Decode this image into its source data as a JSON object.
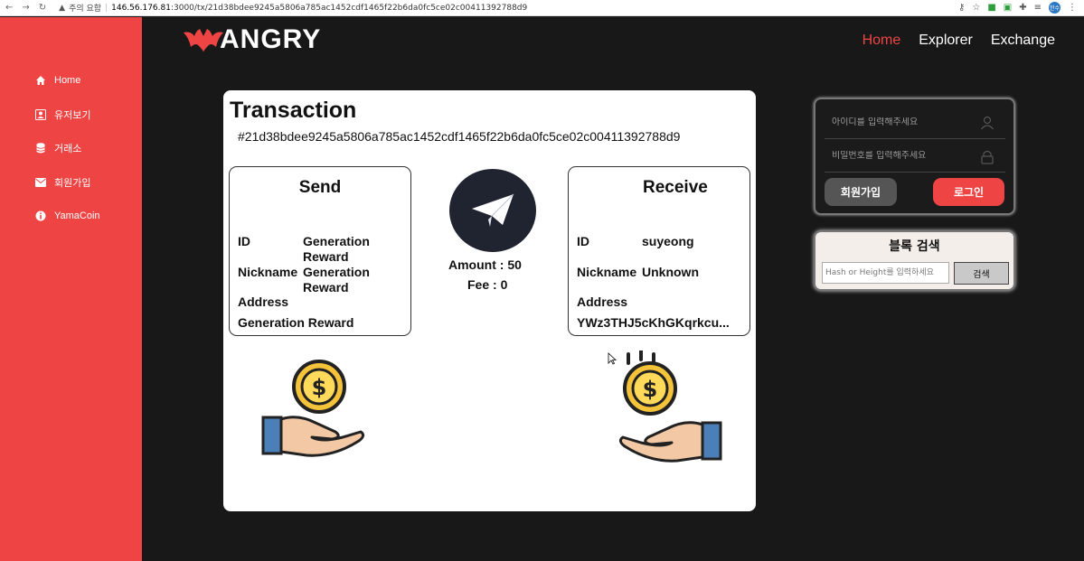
{
  "browser": {
    "warning": "주의 요함",
    "url_host": "146.56.176.81",
    "url_path": ":3000/tx/21d38bdee9245a5806a785ac1452cdf1465f22b6da0fc5ce02c00411392788d9",
    "profile": "한수"
  },
  "sidebar": {
    "items": [
      {
        "label": "Home",
        "icon": "home-icon"
      },
      {
        "label": "유저보기",
        "icon": "user-icon"
      },
      {
        "label": "거래소",
        "icon": "database-icon"
      },
      {
        "label": "회원가입",
        "icon": "envelope-icon"
      },
      {
        "label": "YamaCoin",
        "icon": "info-icon"
      }
    ]
  },
  "header": {
    "logo_text": "ANGRY",
    "nav": [
      {
        "label": "Home",
        "active": true
      },
      {
        "label": "Explorer",
        "active": false
      },
      {
        "label": "Exchange",
        "active": false
      }
    ]
  },
  "transaction": {
    "title": "Transaction",
    "hash": "#21d38bdee9245a5806a785ac1452cdf1465f22b6da0fc5ce02c00411392788d9",
    "send": {
      "heading": "Send",
      "id_label": "ID",
      "id_value": "Generation Reward",
      "nickname_label": "Nickname",
      "nickname_value": "Generation Reward",
      "address_label": "Address",
      "address_value": "Generation Reward"
    },
    "receive": {
      "heading": "Receive",
      "id_label": "ID",
      "id_value": "suyeong",
      "nickname_label": "Nickname",
      "nickname_value": "Unknown",
      "address_label": "Address",
      "address_value": "YWz3THJ5cKhGKqrkcu..."
    },
    "amount_text": "Amount : 50",
    "fee_text": "Fee : 0"
  },
  "login": {
    "id_placeholder": "아이디를 입력해주세요",
    "pw_placeholder": "비밀번호를 입력해주세요",
    "signup_label": "회원가입",
    "login_label": "로그인"
  },
  "block_search": {
    "title": "블록 검색",
    "placeholder": "Hash or Height를 입력하세요",
    "button_label": "검색"
  },
  "colors": {
    "accent": "#ef4444",
    "background": "#181818",
    "card": "#ffffff"
  }
}
